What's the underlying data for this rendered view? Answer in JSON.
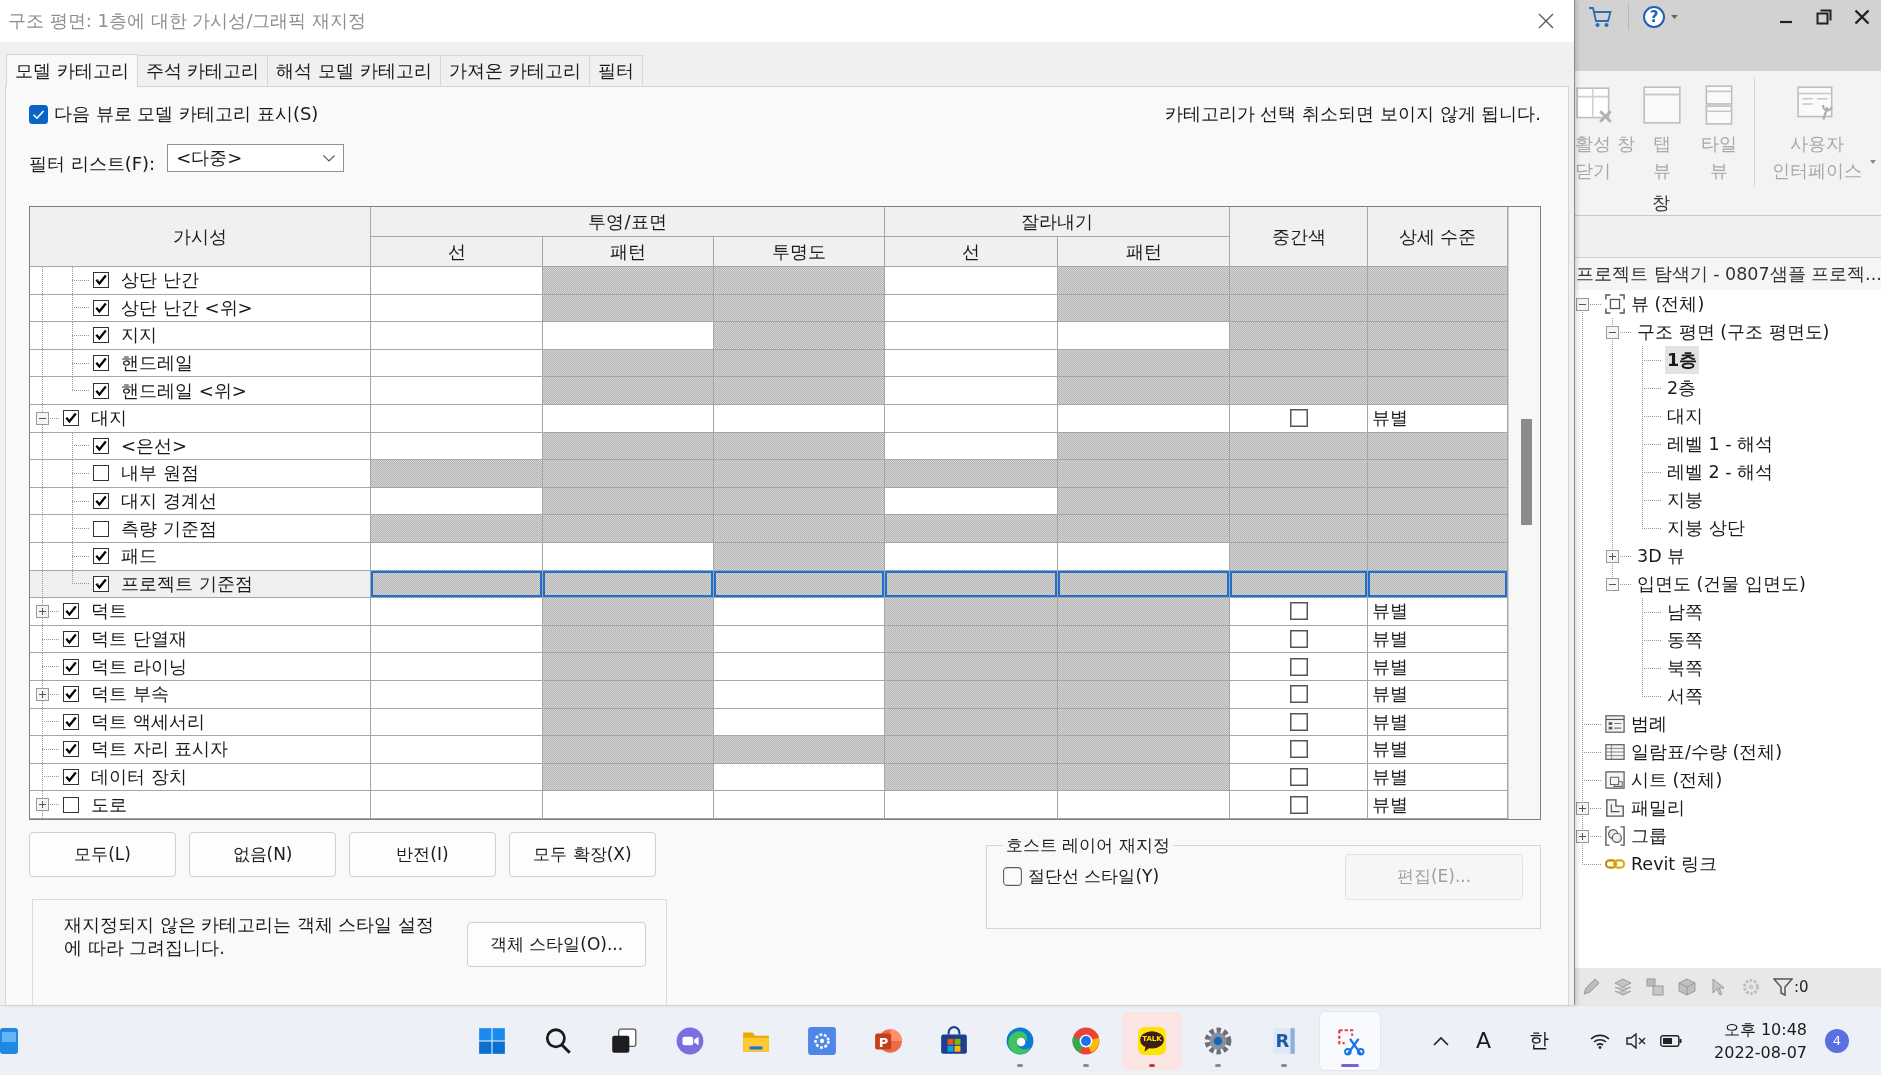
{
  "dialog": {
    "title": "구조 평면: 1층에 대한 가시성/그래픽 재지정",
    "tabs": [
      {
        "label": "모델 카테고리",
        "selected": true
      },
      {
        "label": "주석 카테고리",
        "selected": false
      },
      {
        "label": "해석 모델 카테고리",
        "selected": false
      },
      {
        "label": "가져온 카테고리",
        "selected": false
      },
      {
        "label": "필터",
        "selected": false
      }
    ],
    "show_categories": {
      "label": "다음 뷰로 모델 카테고리 표시(S)",
      "checked": true
    },
    "hint": "카테고리가 선택 취소되면 보이지 않게 됩니다.",
    "filter_list": {
      "label": "필터 리스트(F):",
      "value": "<다중>"
    },
    "table": {
      "header": [
        {
          "label": "가시성"
        },
        {
          "label": "투영/표면",
          "columns": [
            "선",
            "패턴",
            "투명도"
          ]
        },
        {
          "label": "잘라내기",
          "columns": [
            "선",
            "패턴"
          ]
        },
        {
          "label": "중간색"
        },
        {
          "label": "상세 수준"
        }
      ],
      "rows": [
        {
          "children": [
            {
              "name": "상단 난간",
              "checked": true,
              "selected": false,
              "cells": [
                {
                  "disabled": false
                },
                {
                  "disabled": true
                },
                {
                  "disabled": true
                },
                {
                  "disabled": false
                },
                {
                  "disabled": true
                }
              ],
              "halftone": {
                "disabled": true
              },
              "detail_level": {
                "disabled": true
              }
            },
            {
              "name": "상단 난간 <위>",
              "checked": true,
              "selected": false,
              "cells": [
                {
                  "disabled": false
                },
                {
                  "disabled": true
                },
                {
                  "disabled": true
                },
                {
                  "disabled": false
                },
                {
                  "disabled": true
                }
              ],
              "halftone": {
                "disabled": true
              },
              "detail_level": {
                "disabled": true
              }
            },
            {
              "name": "지지",
              "checked": true,
              "selected": false,
              "cells": [
                {
                  "disabled": false
                },
                {
                  "disabled": false
                },
                {
                  "disabled": true
                },
                {
                  "disabled": false
                },
                {
                  "disabled": false
                }
              ],
              "halftone": {
                "disabled": true
              },
              "detail_level": {
                "disabled": true
              }
            },
            {
              "name": "핸드레일",
              "checked": true,
              "selected": false,
              "cells": [
                {
                  "disabled": false
                },
                {
                  "disabled": true
                },
                {
                  "disabled": true
                },
                {
                  "disabled": false
                },
                {
                  "disabled": true
                }
              ],
              "halftone": {
                "disabled": true
              },
              "detail_level": {
                "disabled": true
              }
            },
            {
              "name": "핸드레일 <위>",
              "checked": true,
              "selected": false,
              "cells": [
                {
                  "disabled": false
                },
                {
                  "disabled": true
                },
                {
                  "disabled": true
                },
                {
                  "disabled": false
                },
                {
                  "disabled": true
                }
              ],
              "halftone": {
                "disabled": true
              },
              "detail_level": {
                "disabled": true
              }
            }
          ]
        },
        {
          "name": "대지",
          "checked": true,
          "selected": false,
          "expanded": true,
          "cells": [
            {
              "disabled": false
            },
            {
              "disabled": false
            },
            {
              "disabled": false
            },
            {
              "disabled": false
            },
            {
              "disabled": false
            }
          ],
          "halftone": {
            "disabled": false,
            "checked": false
          },
          "detail_level": {
            "disabled": false,
            "value": "뷰별"
          },
          "children": [
            {
              "name": "<은선>",
              "checked": true,
              "selected": false,
              "cells": [
                {
                  "disabled": false
                },
                {
                  "disabled": true
                },
                {
                  "disabled": true
                },
                {
                  "disabled": false
                },
                {
                  "disabled": true
                }
              ],
              "halftone": {
                "disabled": true
              },
              "detail_level": {
                "disabled": true
              }
            },
            {
              "name": "내부 원점",
              "checked": false,
              "selected": false,
              "cells": [
                {
                  "disabled": true
                },
                {
                  "disabled": true
                },
                {
                  "disabled": true
                },
                {
                  "disabled": true
                },
                {
                  "disabled": true
                }
              ],
              "halftone": {
                "disabled": true
              },
              "detail_level": {
                "disabled": true
              }
            },
            {
              "name": "대지 경계선",
              "checked": true,
              "selected": false,
              "cells": [
                {
                  "disabled": false
                },
                {
                  "disabled": true
                },
                {
                  "disabled": true
                },
                {
                  "disabled": false
                },
                {
                  "disabled": true
                }
              ],
              "halftone": {
                "disabled": true
              },
              "detail_level": {
                "disabled": true
              }
            },
            {
              "name": "측량 기준점",
              "checked": false,
              "selected": false,
              "cells": [
                {
                  "disabled": true
                },
                {
                  "disabled": true
                },
                {
                  "disabled": true
                },
                {
                  "disabled": true
                },
                {
                  "disabled": true
                }
              ],
              "halftone": {
                "disabled": true
              },
              "detail_level": {
                "disabled": true
              }
            },
            {
              "name": "패드",
              "checked": true,
              "selected": false,
              "cells": [
                {
                  "disabled": false
                },
                {
                  "disabled": false
                },
                {
                  "disabled": true
                },
                {
                  "disabled": false
                },
                {
                  "disabled": false
                }
              ],
              "halftone": {
                "disabled": true
              },
              "detail_level": {
                "disabled": true
              }
            },
            {
              "name": "프로젝트 기준점",
              "checked": true,
              "selected": true,
              "cells": [
                {
                  "disabled": true
                },
                {
                  "disabled": true
                },
                {
                  "disabled": true
                },
                {
                  "disabled": true
                },
                {
                  "disabled": true
                }
              ],
              "halftone": {
                "disabled": true
              },
              "detail_level": {
                "disabled": true
              }
            }
          ]
        },
        {
          "name": "덕트",
          "checked": true,
          "selected": false,
          "expanded": false,
          "cells": [
            {
              "disabled": false
            },
            {
              "disabled": true
            },
            {
              "disabled": false
            },
            {
              "disabled": true
            },
            {
              "disabled": true
            }
          ],
          "halftone": {
            "disabled": false,
            "checked": false
          },
          "detail_level": {
            "disabled": false,
            "value": "뷰별"
          }
        },
        {
          "name": "덕트 단열재",
          "checked": true,
          "selected": false,
          "cells": [
            {
              "disabled": false
            },
            {
              "disabled": true
            },
            {
              "disabled": false
            },
            {
              "disabled": true
            },
            {
              "disabled": true
            }
          ],
          "halftone": {
            "disabled": false,
            "checked": false
          },
          "detail_level": {
            "disabled": false,
            "value": "뷰별"
          }
        },
        {
          "name": "덕트 라이닝",
          "checked": true,
          "selected": false,
          "cells": [
            {
              "disabled": false
            },
            {
              "disabled": true
            },
            {
              "disabled": false
            },
            {
              "disabled": true
            },
            {
              "disabled": true
            }
          ],
          "halftone": {
            "disabled": false,
            "checked": false
          },
          "detail_level": {
            "disabled": false,
            "value": "뷰별"
          }
        },
        {
          "name": "덕트 부속",
          "checked": true,
          "selected": false,
          "expanded": false,
          "cells": [
            {
              "disabled": false
            },
            {
              "disabled": true
            },
            {
              "disabled": false
            },
            {
              "disabled": true
            },
            {
              "disabled": true
            }
          ],
          "halftone": {
            "disabled": false,
            "checked": false
          },
          "detail_level": {
            "disabled": false,
            "value": "뷰별"
          }
        },
        {
          "name": "덕트 액세서리",
          "checked": true,
          "selected": false,
          "cells": [
            {
              "disabled": false
            },
            {
              "disabled": true
            },
            {
              "disabled": false
            },
            {
              "disabled": true
            },
            {
              "disabled": true
            }
          ],
          "halftone": {
            "disabled": false,
            "checked": false
          },
          "detail_level": {
            "disabled": false,
            "value": "뷰별"
          }
        },
        {
          "name": "덕트 자리 표시자",
          "checked": true,
          "selected": false,
          "cells": [
            {
              "disabled": false
            },
            {
              "disabled": true
            },
            {
              "disabled": true
            },
            {
              "disabled": true
            },
            {
              "disabled": true
            }
          ],
          "halftone": {
            "disabled": false,
            "checked": false
          },
          "detail_level": {
            "disabled": false,
            "value": "뷰별"
          }
        },
        {
          "name": "데이터 장치",
          "checked": true,
          "selected": false,
          "cells": [
            {
              "disabled": false
            },
            {
              "disabled": true
            },
            {
              "disabled": false
            },
            {
              "disabled": true
            },
            {
              "disabled": true
            }
          ],
          "halftone": {
            "disabled": false,
            "checked": false
          },
          "detail_level": {
            "disabled": false,
            "value": "뷰별"
          }
        },
        {
          "name": "도로",
          "checked": false,
          "selected": false,
          "expanded": false,
          "cells": [
            {
              "disabled": false
            },
            {
              "disabled": false
            },
            {
              "disabled": false
            },
            {
              "disabled": false
            },
            {
              "disabled": false
            }
          ],
          "halftone": {
            "disabled": false,
            "checked": false
          },
          "detail_level": {
            "disabled": false,
            "value": "뷰별"
          }
        }
      ]
    },
    "buttons": [
      "모두(L)",
      "없음(N)",
      "반전(I)",
      "모두 확장(X)"
    ],
    "note": "재지정되지 않은 카테고리는 객체 스타일 설정\n에 따라 그려집니다.",
    "object_styles_button": "객체 스타일(O)...",
    "host_layers": {
      "title": "호스트 레이어 재지정",
      "cut_line_styles": {
        "label": "절단선 스타일(Y)",
        "checked": false
      },
      "edit_button": {
        "label": "편집(E)...",
        "disabled": true
      }
    }
  },
  "revit": {
    "titlebar": {
      "help": "?"
    },
    "ribbon": {
      "buttons": [
        {
          "kind": "close-inactive",
          "label": "활성 창\n닫기",
          "disabled": true
        },
        {
          "kind": "tab-views",
          "label": "탭\n뷰",
          "disabled": true
        },
        {
          "kind": "tile-views",
          "label": "타일\n뷰",
          "disabled": true
        },
        {
          "kind": "user-interface",
          "label": "사용자\n인터페이스",
          "disabled": true,
          "dropdown": true
        }
      ],
      "panel": "창"
    },
    "browser": {
      "title": "프로젝트 탐색기 - 0807샘플 프로젝...",
      "tree": [
        {
          "label": "뷰 (전체)",
          "kind": "views",
          "expanded": true,
          "selected": false,
          "children": [
            {
              "label": "구조 평면 (구조 평면도)",
              "expanded": true,
              "selected": false,
              "children": [
                {
                  "label": "1층",
                  "selected": true
                },
                {
                  "label": "2층",
                  "selected": false
                },
                {
                  "label": "대지",
                  "selected": false
                },
                {
                  "label": "레벨 1 - 해석",
                  "selected": false
                },
                {
                  "label": "레벨 2 - 해석",
                  "selected": false
                },
                {
                  "label": "지붕",
                  "selected": false
                },
                {
                  "label": "지붕 상단",
                  "selected": false
                }
              ]
            },
            {
              "label": "3D 뷰",
              "expanded": false,
              "selected": false
            },
            {
              "label": "입면도 (건물 입면도)",
              "expanded": true,
              "selected": false,
              "children": [
                {
                  "label": "남쪽",
                  "selected": false
                },
                {
                  "label": "동쪽",
                  "selected": false
                },
                {
                  "label": "북쪽",
                  "selected": false
                },
                {
                  "label": "서쪽",
                  "selected": false
                }
              ]
            }
          ]
        },
        {
          "label": "범례",
          "kind": "legend",
          "selected": false
        },
        {
          "label": "일람표/수량 (전체)",
          "kind": "schedule",
          "selected": false
        },
        {
          "label": "시트 (전체)",
          "kind": "sheet",
          "selected": false
        },
        {
          "label": "패밀리",
          "kind": "family",
          "expanded": false,
          "selected": false
        },
        {
          "label": "그룹",
          "kind": "group",
          "expanded": false,
          "selected": false
        },
        {
          "label": "Revit 링크",
          "kind": "link",
          "selected": false
        }
      ]
    },
    "status": {
      "filter_count": ":0"
    }
  },
  "taskbar": {
    "apps": [
      {
        "kind": "start",
        "running": false,
        "flashing": false,
        "selected": false
      },
      {
        "kind": "search",
        "running": false,
        "flashing": false,
        "selected": false
      },
      {
        "kind": "task-view",
        "running": false,
        "flashing": false,
        "selected": false
      },
      {
        "kind": "chat",
        "running": false,
        "flashing": false,
        "selected": false
      },
      {
        "kind": "explorer",
        "running": false,
        "flashing": false,
        "selected": false
      },
      {
        "kind": "gear-tile",
        "running": false,
        "flashing": false,
        "selected": false
      },
      {
        "kind": "presentation",
        "label": "P",
        "running": false,
        "flashing": false,
        "selected": false
      },
      {
        "kind": "store",
        "running": false,
        "flashing": false,
        "selected": false
      },
      {
        "kind": "edge",
        "running": true,
        "flashing": false,
        "selected": false
      },
      {
        "kind": "chrome",
        "running": true,
        "flashing": false,
        "selected": false
      },
      {
        "kind": "talk",
        "label": "TALK",
        "running": true,
        "flashing": true,
        "selected": false
      },
      {
        "kind": "settings",
        "running": true,
        "flashing": false,
        "selected": false
      },
      {
        "kind": "revit",
        "label": "R",
        "running": true,
        "flashing": false,
        "selected": false
      },
      {
        "kind": "snipping",
        "running": true,
        "flashing": false,
        "selected": true
      }
    ],
    "tray": {
      "input_mode": "A",
      "language": "한",
      "time": "오후 10:48",
      "date": "2022-08-07",
      "notifications": "4"
    }
  }
}
